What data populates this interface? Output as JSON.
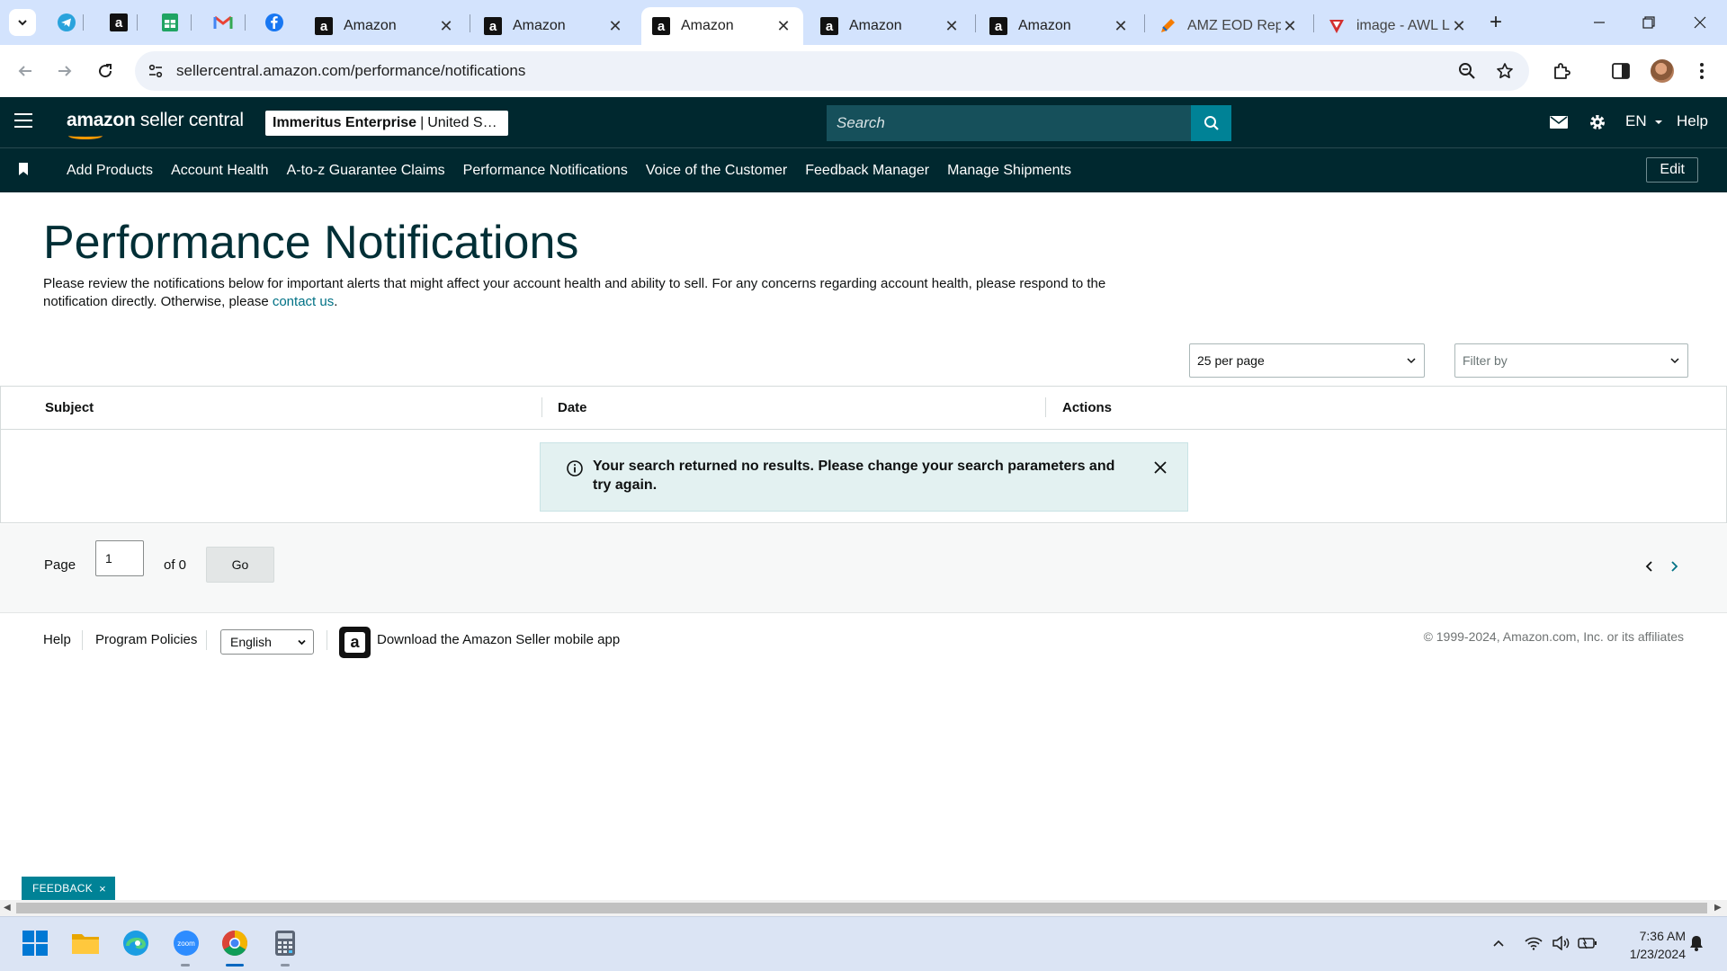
{
  "browser": {
    "tabs": [
      {
        "title": "Amazon",
        "active": false
      },
      {
        "title": "Amazon",
        "active": false
      },
      {
        "title": "Amazon",
        "active": true
      },
      {
        "title": "Amazon",
        "active": false
      },
      {
        "title": "Amazon",
        "active": false
      },
      {
        "title": "AMZ EOD Rep",
        "active": false
      },
      {
        "title": "image - AWL L",
        "active": false
      }
    ],
    "pinned_icons": [
      "telegram-icon",
      "amazon-icon",
      "sheets-icon",
      "gmail-icon",
      "facebook-icon"
    ],
    "url": "sellercentral.amazon.com/performance/notifications"
  },
  "header": {
    "logo_bold": "amazon",
    "logo_rest": " seller central",
    "merchant_name": "Immeritus Enterprise",
    "merchant_sep": "|",
    "marketplace": "United States",
    "search_placeholder": "Search",
    "language": "EN",
    "help": "Help"
  },
  "nav": {
    "links": [
      "Add Products",
      "Account Health",
      "A-to-z Guarantee Claims",
      "Performance Notifications",
      "Voice of the Customer",
      "Feedback Manager",
      "Manage Shipments"
    ],
    "edit": "Edit"
  },
  "page": {
    "title": "Performance Notifications",
    "description": "Please review the notifications below for important alerts that might affect your account health and ability to sell. For any concerns regarding account health, please respond to the notification directly. Otherwise, please ",
    "contact_link": "contact us",
    "description_end": ".",
    "per_page": "25 per page",
    "filter_placeholder": "Filter by"
  },
  "table": {
    "columns": [
      "Subject",
      "Date",
      "Actions"
    ],
    "alert_message": "Your search returned no results. Please change your search parameters and try again."
  },
  "pager": {
    "page_label": "Page",
    "page_value": "1",
    "of_label": "of 0",
    "go": "Go"
  },
  "footer": {
    "help": "Help",
    "program_policies": "Program Policies",
    "language": "English",
    "app_text": "Download the Amazon Seller mobile app",
    "copyright": "© 1999-2024, Amazon.com, Inc. or its affiliates"
  },
  "feedback": {
    "label": "FEEDBACK",
    "close": "×"
  },
  "taskbar": {
    "apps": [
      "windows-start-icon",
      "file-explorer-icon",
      "edge-icon",
      "zoom-icon",
      "chrome-icon",
      "calculator-icon"
    ],
    "zoom_label": "zoom",
    "time": "7:36 AM",
    "date": "1/23/2024"
  },
  "colors": {
    "header_bg": "#00282f",
    "accent": "#008296",
    "link": "#007185",
    "title": "#002f36",
    "alert_bg": "#e3f1f1"
  }
}
